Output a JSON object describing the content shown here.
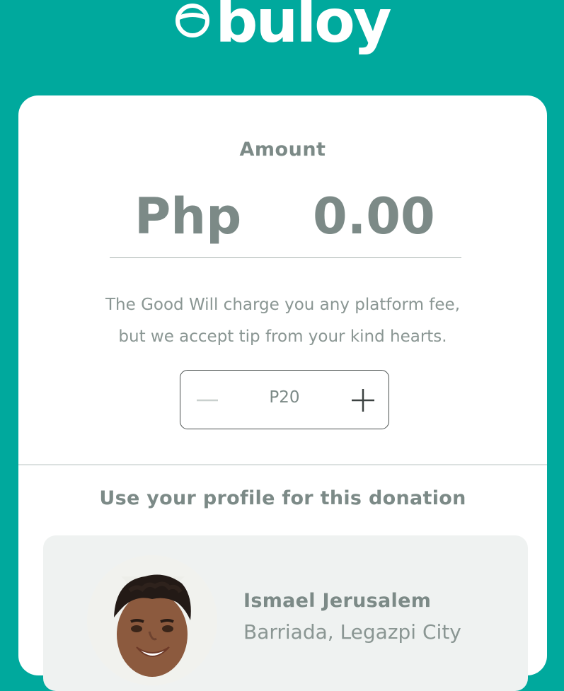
{
  "brand": {
    "name": "buloy",
    "icon": "buloy-logo-icon",
    "background_color": "#00A99D"
  },
  "donation": {
    "amount_label": "Amount",
    "currency": "Php",
    "amount": "0.00",
    "fee_note_line1": "The Good Will charge you any platform fee,",
    "fee_note_line2": "but we accept tip from your kind hearts."
  },
  "tip": {
    "value": "P20",
    "decrement_icon": "minus-icon",
    "increment_icon": "plus-icon"
  },
  "profile": {
    "heading": "Use your profile for this donation",
    "name": "Ismael Jerusalem",
    "location": "Barriada, Legazpi City"
  }
}
